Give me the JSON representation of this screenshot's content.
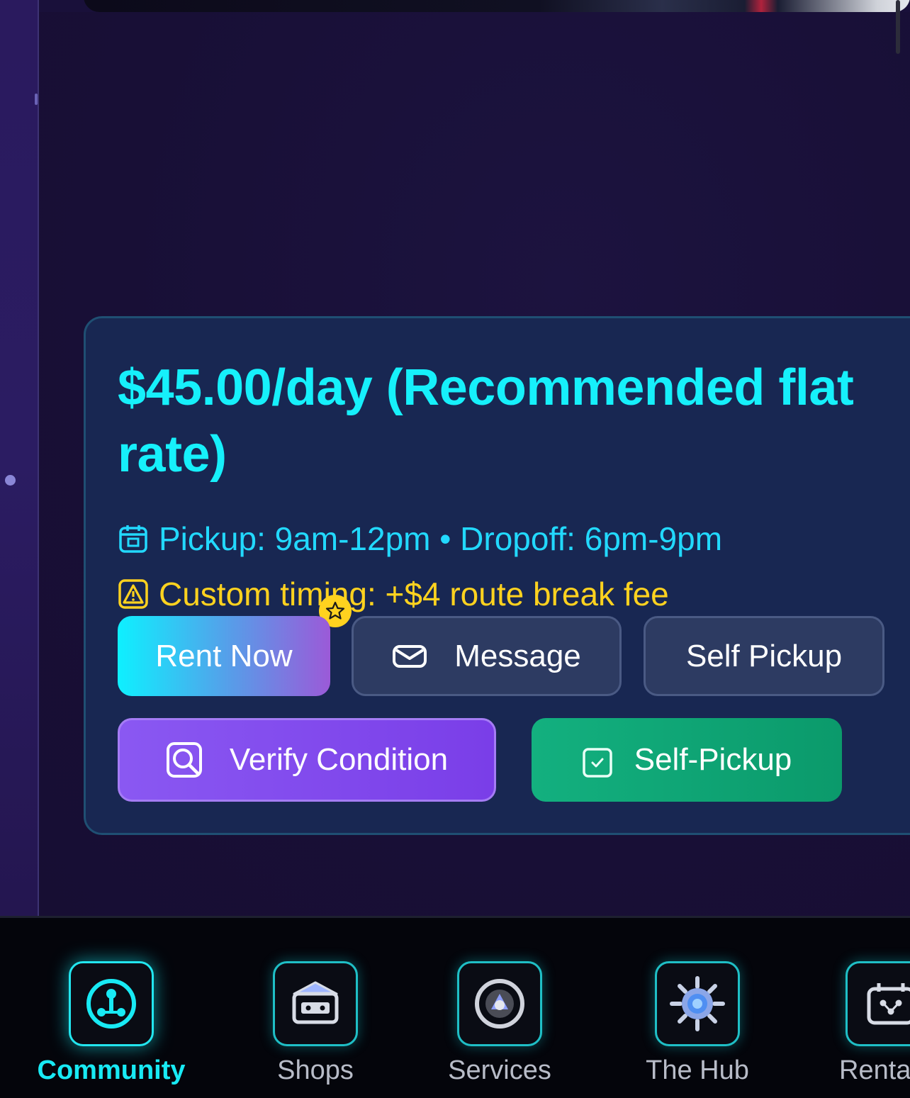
{
  "listing": {
    "price_text": "$45.00/day (Recommended flat rate)",
    "pickup_window": "Pickup: 9am-12pm • Dropoff: 6pm-9pm",
    "custom_timing": "Custom timing: +$4 route break fee"
  },
  "actions": {
    "rent_now": "Rent Now",
    "message": "Message",
    "self_pickup": "Self Pickup",
    "verify_condition": "Verify Condition",
    "self_pickup_confirm": "Self-Pickup"
  },
  "icons": {
    "pickup": "calendar-icon",
    "custom_timing": "warning-icon",
    "badge": "star-icon",
    "message": "envelope-icon",
    "verify": "magnifier-icon",
    "self_pickup_confirm": "checkbox-icon"
  },
  "bottom_nav": {
    "items": [
      {
        "label": "Community",
        "icon": "community-icon",
        "active": true
      },
      {
        "label": "Shops",
        "icon": "shop-icon",
        "active": false
      },
      {
        "label": "Services",
        "icon": "services-icon",
        "active": false
      },
      {
        "label": "The Hub",
        "icon": "hub-icon",
        "active": false
      },
      {
        "label": "Rentals",
        "icon": "rentals-icon",
        "active": false
      }
    ]
  },
  "colors": {
    "price": "#16f0fb",
    "pickup_text": "#22d9ff",
    "warning_text": "#ffd21f",
    "active_nav": "#18eaf4"
  }
}
